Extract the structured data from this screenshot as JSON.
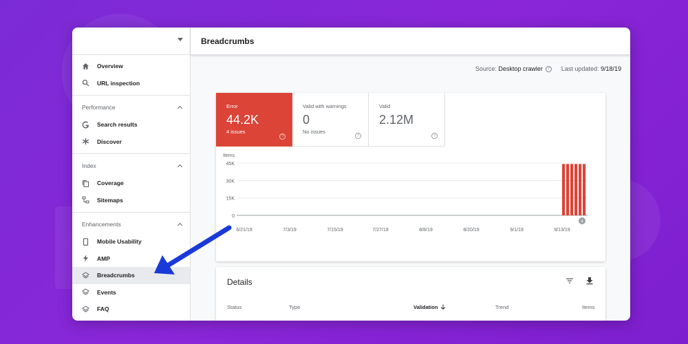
{
  "sidebar": {
    "top_items": [
      {
        "label": "Overview",
        "icon": "home-icon"
      },
      {
        "label": "URL inspection",
        "icon": "search-icon"
      }
    ],
    "groups": [
      {
        "title": "Performance",
        "items": [
          {
            "label": "Search results",
            "icon": "google-icon"
          },
          {
            "label": "Discover",
            "icon": "asterisk-icon"
          }
        ]
      },
      {
        "title": "Index",
        "items": [
          {
            "label": "Coverage",
            "icon": "copy-icon"
          },
          {
            "label": "Sitemaps",
            "icon": "sitemap-icon"
          }
        ]
      },
      {
        "title": "Enhancements",
        "items": [
          {
            "label": "Mobile Usability",
            "icon": "phone-icon"
          },
          {
            "label": "AMP",
            "icon": "bolt-icon"
          },
          {
            "label": "Breadcrumbs",
            "icon": "layers-icon",
            "active": true
          },
          {
            "label": "Events",
            "icon": "layers-icon"
          },
          {
            "label": "FAQ",
            "icon": "layers-icon"
          }
        ]
      }
    ]
  },
  "header": {
    "title": "Breadcrumbs"
  },
  "meta": {
    "source_label": "Source:",
    "source_value": "Desktop crawler",
    "updated_label": "Last updated:",
    "updated_value": "9/18/19"
  },
  "tiles": [
    {
      "label": "Error",
      "value": "44.2K",
      "sub": "4 issues",
      "color": "#db4437"
    },
    {
      "label": "Valid with warnings",
      "value": "0",
      "sub": "No issues"
    },
    {
      "label": "Valid",
      "value": "2.12M",
      "sub": ""
    }
  ],
  "chart_data": {
    "type": "bar",
    "ylabel": "Items",
    "yticks": [
      "45K",
      "30K",
      "15K",
      "0"
    ],
    "ylim": [
      0,
      45000
    ],
    "xticks": [
      "6/21/19",
      "7/3/19",
      "7/15/19",
      "7/27/19",
      "8/8/19",
      "8/20/19",
      "9/1/19",
      "9/13/19"
    ],
    "series": [
      {
        "values": [
          44200,
          44200,
          44200,
          44200,
          44200,
          44200
        ]
      }
    ],
    "bar_color": "#db4437",
    "annotation": "4"
  },
  "details": {
    "title": "Details",
    "columns": [
      "Status",
      "Type",
      "Validation",
      "Trend",
      "Items"
    ]
  }
}
